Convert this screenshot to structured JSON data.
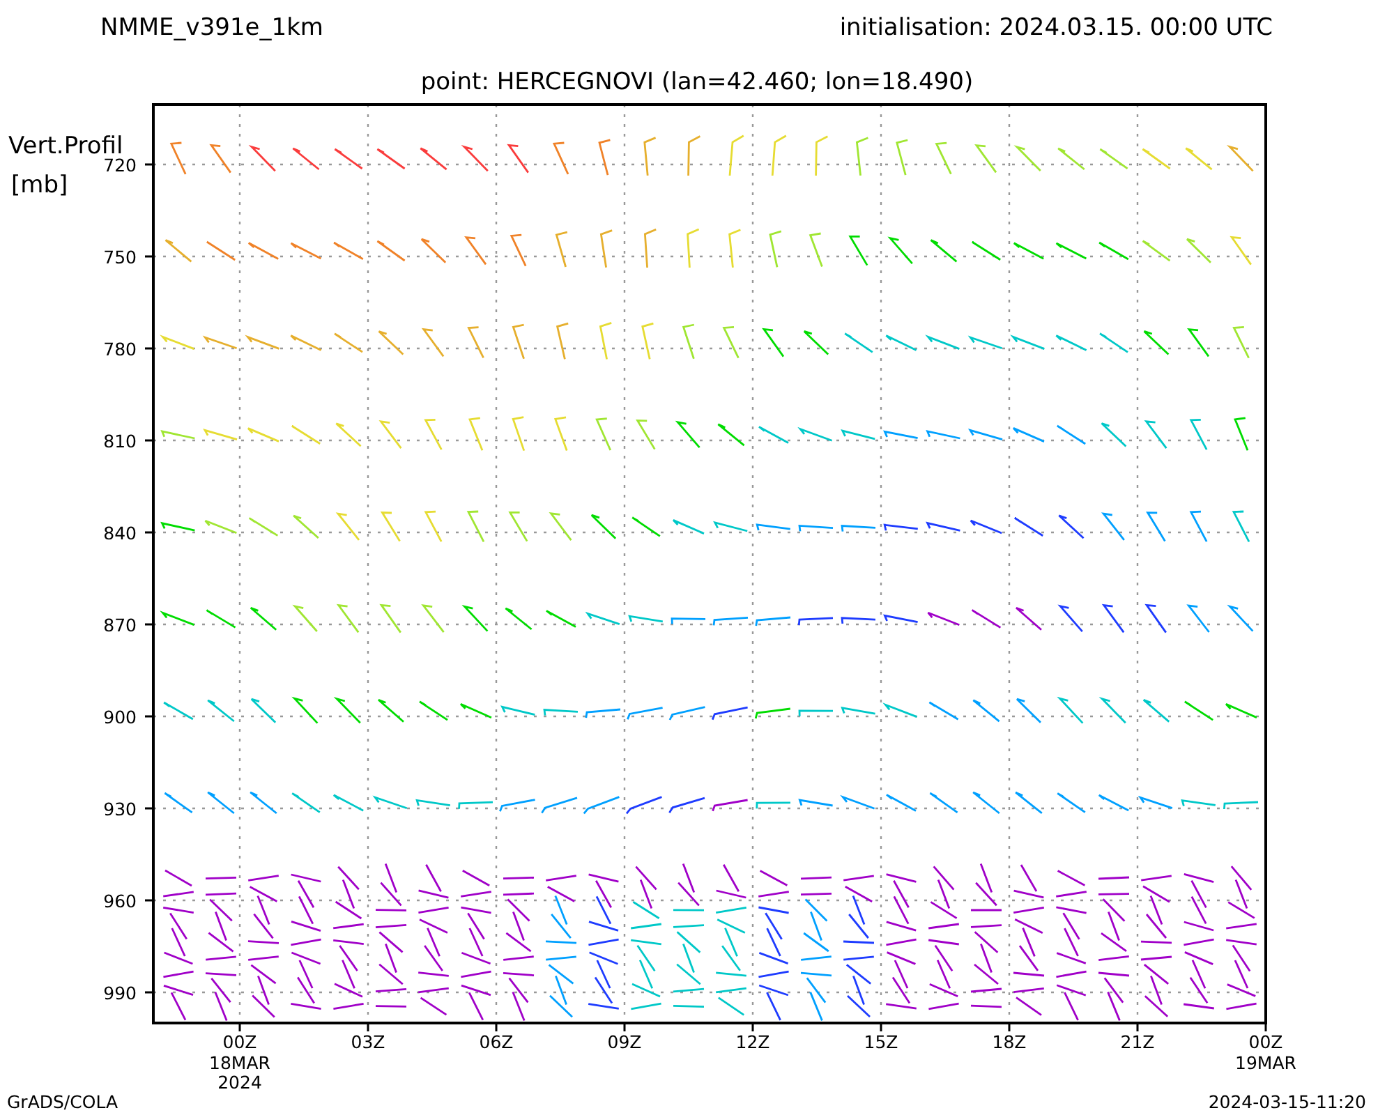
{
  "header": {
    "model": "NMME_v391e_1km",
    "initialisation": "initialisation: 2024.03.15. 00:00 UTC",
    "point": "point: HERCEGNOVI (lan=42.460; lon=18.490)"
  },
  "y_axis": {
    "title_lines": [
      "Vert.Profil",
      "[mb]"
    ],
    "ticks": [
      "720",
      "750",
      "780",
      "810",
      "840",
      "870",
      "900",
      "930",
      "960",
      "990"
    ]
  },
  "x_axis": {
    "ticks": [
      {
        "label": "00Z",
        "sub": [
          "18MAR",
          "2024"
        ]
      },
      {
        "label": "03Z"
      },
      {
        "label": "06Z"
      },
      {
        "label": "09Z"
      },
      {
        "label": "12Z"
      },
      {
        "label": "15Z"
      },
      {
        "label": "18Z"
      },
      {
        "label": "21Z"
      },
      {
        "label": "00Z",
        "sub": [
          "19MAR"
        ]
      }
    ]
  },
  "footer": {
    "left": "GrADS/COLA",
    "right": "2024-03-15-11:20"
  }
}
